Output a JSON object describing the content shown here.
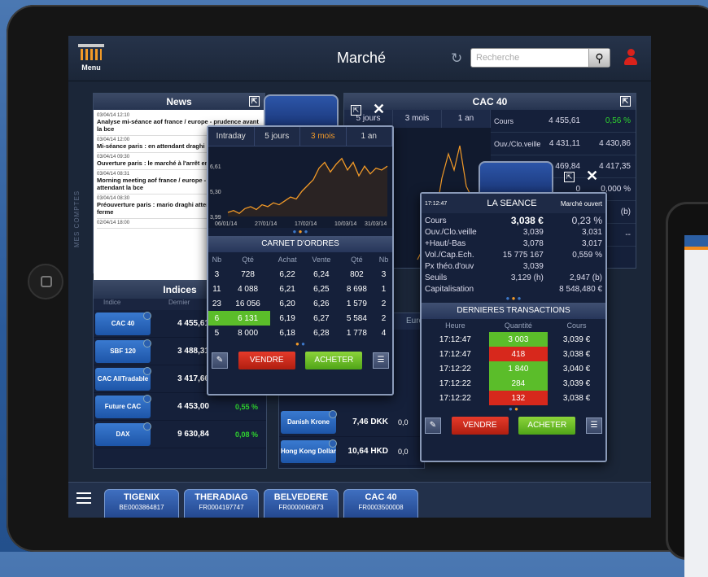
{
  "header": {
    "menu_label": "Menu",
    "title": "Marché",
    "search_placeholder": "Recherche"
  },
  "side_label": "MES COMPTES",
  "news": {
    "title": "News",
    "items": [
      {
        "time": "03/04/14 12:10",
        "headline": "Analyse mi-séance aof france / europe - prudence avant la bce"
      },
      {
        "time": "03/04/14 12:00",
        "headline": "Mi-séance paris : en attendant draghi"
      },
      {
        "time": "03/04/14 09:30",
        "headline": "Ouverture paris : le marché à l'arrêt en attendant draghi"
      },
      {
        "time": "03/04/14 08:31",
        "headline": "Morning meeting aof france / europe - hausse en vue en attendant la bce"
      },
      {
        "time": "03/04/14 08:30",
        "headline": "Préouverture paris : mario draghi attendu au tournant, ferme"
      },
      {
        "time": "02/04/14 18:00",
        "headline": ""
      }
    ]
  },
  "cac": {
    "title": "CAC 40",
    "tabs": [
      "5 jours",
      "3 mois",
      "1 an"
    ],
    "rows": [
      {
        "k": "Cours",
        "v": "4 455,61",
        "v2": "0,56 %"
      },
      {
        "k": "Ouv./Clo.veille",
        "v": "4 431,11",
        "v2": "4 430,86"
      },
      {
        "k": "",
        "v": "469,84",
        "v2": "4 417,35"
      },
      {
        "k": "",
        "v": "0",
        "v2": "0,000 %"
      },
      {
        "k": "",
        "v": "",
        "v2": "(b)"
      },
      {
        "k": "",
        "v": "",
        "v2": "--"
      }
    ]
  },
  "indices": {
    "title": "Indices",
    "col1": "Indice",
    "col2": "Dernier",
    "rows": [
      {
        "name": "CAC 40",
        "value": "4 455,61",
        "pct": ""
      },
      {
        "name": "SBF 120",
        "value": "3 488,31",
        "pct": ""
      },
      {
        "name": "CAC AllTradable",
        "value": "3 417,66",
        "pct": ""
      },
      {
        "name": "Future CAC",
        "value": "4 453,00",
        "pct": "0,55 %"
      },
      {
        "name": "DAX",
        "value": "9 630,84",
        "pct": "0,08 %"
      }
    ]
  },
  "fx": {
    "tab": "Euro",
    "rows": [
      {
        "name": "Danish Krone",
        "value": "7,46 DKK",
        "extra": "0,0"
      },
      {
        "name": "Hong Kong Dollar",
        "value": "10,64 HKD",
        "extra": "0,0"
      }
    ]
  },
  "popup1": {
    "tabs": [
      "Intraday",
      "5 jours",
      "3 mois",
      "1 an"
    ],
    "active_tab": "3 mois",
    "chart_data": {
      "type": "line",
      "x": [
        "06/01/14",
        "27/01/14",
        "17/02/14",
        "10/03/14",
        "31/03/14"
      ],
      "yticks": [
        "3,99",
        "5,30",
        "6,61"
      ],
      "values": [
        4.2,
        4.3,
        4.15,
        4.4,
        4.5,
        4.35,
        4.6,
        4.5,
        4.7,
        4.6,
        4.8,
        5.0,
        4.9,
        5.3,
        5.6,
        5.9,
        6.5,
        6.8,
        6.3,
        6.7,
        7.0,
        6.4,
        6.8,
        6.1,
        6.6,
        6.2,
        6.5,
        6.4,
        6.6
      ]
    },
    "orderbook": {
      "title": "CARNET D'ORDRES",
      "headers": [
        "Nb",
        "Qté",
        "Achat",
        "Vente",
        "Qté",
        "Nb"
      ],
      "rows": [
        [
          "3",
          "728",
          "6,22",
          "6,24",
          "802",
          "3"
        ],
        [
          "11",
          "4 088",
          "6,21",
          "6,25",
          "8 698",
          "1"
        ],
        [
          "23",
          "16 056",
          "6,20",
          "6,26",
          "1 579",
          "2"
        ],
        [
          "6",
          "6 131",
          "6,19",
          "6,27",
          "5 584",
          "2"
        ],
        [
          "5",
          "8 000",
          "6,18",
          "6,28",
          "1 778",
          "4"
        ]
      ]
    },
    "sell": "VENDRE",
    "buy": "ACHETER"
  },
  "popup2": {
    "time": "17:12:47",
    "title": "LA SEANCE",
    "status": "Marché ouvert",
    "seance": [
      {
        "k": "Cours",
        "a": "3,038 €",
        "b": "0,23 %"
      },
      {
        "k": "Ouv./Clo.veille",
        "a": "3,039",
        "b": "3,031"
      },
      {
        "k": "+Haut/-Bas",
        "a": "3,078",
        "b": "3,017"
      },
      {
        "k": "Vol./Cap.Ech.",
        "a": "15 775 167",
        "b": "0,559 %"
      },
      {
        "k": "Px théo.d'ouv",
        "a": "3,039",
        "b": ""
      },
      {
        "k": "Seuils",
        "a": "3,129  (h)",
        "b": "2,947  (b)"
      },
      {
        "k": "Capitalisation",
        "a": "",
        "b": "8 548,480 €"
      }
    ],
    "trans": {
      "title": "DERNIERES TRANSACTIONS",
      "headers": [
        "Heure",
        "Quantité",
        "Cours"
      ],
      "rows": [
        [
          "17:12:47",
          "3 003",
          "3,039 €",
          "g"
        ],
        [
          "17:12:47",
          "418",
          "3,038 €",
          "r"
        ],
        [
          "17:12:22",
          "1 840",
          "3,040 €",
          "g"
        ],
        [
          "17:12:22",
          "284",
          "3,039 €",
          "g"
        ],
        [
          "17:12:22",
          "132",
          "3,038 €",
          "r"
        ]
      ]
    },
    "sell": "VENDRE",
    "buy": "ACHETER"
  },
  "bottom_tabs": [
    {
      "name": "TIGENIX",
      "code": "BE0003864817"
    },
    {
      "name": "THERADIAG",
      "code": "FR0004197747"
    },
    {
      "name": "BELVEDERE",
      "code": "FR0000060873"
    },
    {
      "name": "CAC 40",
      "code": "FR0003500008"
    }
  ],
  "colors": {
    "up": "#2fd32f",
    "down": "#d7281c",
    "accent": "#f29a28"
  }
}
